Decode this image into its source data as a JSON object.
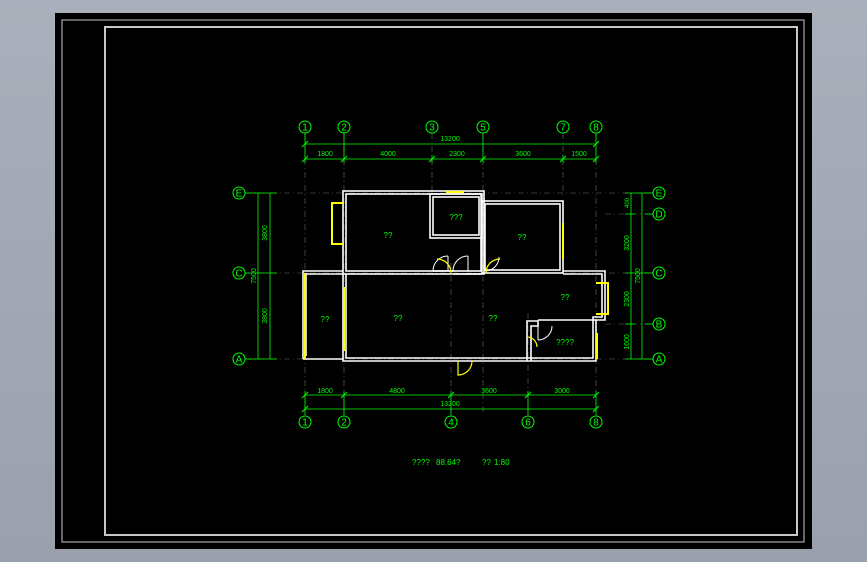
{
  "colors": {
    "background": "#9ca2ae",
    "paper": "#000000",
    "dimension": "#00ff00",
    "wall": "#ffffff",
    "window": "#ffff00",
    "frame": "#c8c8c8"
  },
  "axes": {
    "top": [
      "1",
      "2",
      "3",
      "5",
      "7",
      "8"
    ],
    "bottom": [
      "1",
      "2",
      "4",
      "6",
      "8"
    ],
    "left": [
      "E",
      "C",
      "A"
    ],
    "right": [
      "E",
      "D",
      "C",
      "B",
      "A"
    ]
  },
  "dims": {
    "top_total": "13200",
    "top_segments": [
      "1800",
      "4000",
      "2300",
      "3600",
      "1500"
    ],
    "bottom_total": "13200",
    "bottom_segments": [
      "1800",
      "4800",
      "3600",
      "3000"
    ],
    "left_segments": [
      "3800",
      "3800"
    ],
    "left_total": "7500",
    "right_segments": [
      "400",
      "3200",
      "2300",
      "1600"
    ],
    "right_total": "7500"
  },
  "rooms": {
    "r1": "??",
    "r2": "???",
    "r3": "??",
    "r4": "??",
    "r5": "??",
    "r6": "??",
    "r7": "??",
    "r8": "????"
  },
  "caption": {
    "part1": "????",
    "area": "88.64?",
    "part2": "??",
    "scale": "1:80"
  }
}
